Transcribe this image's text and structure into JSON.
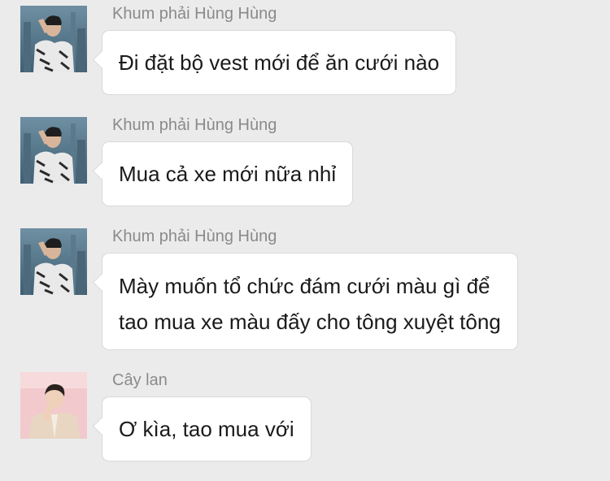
{
  "messages": [
    {
      "sender": "Khum phải Hùng Hùng",
      "avatar_icon": "male-avatar-city-icon",
      "lines": [
        "Đi đặt bộ vest mới để ăn cưới nào"
      ]
    },
    {
      "sender": "Khum phải Hùng Hùng",
      "avatar_icon": "male-avatar-city-icon",
      "lines": [
        "Mua cả xe mới nữa nhỉ"
      ]
    },
    {
      "sender": "Khum phải Hùng Hùng",
      "avatar_icon": "male-avatar-city-icon",
      "lines": [
        "Mày muốn tổ chức đám cưới màu gì để",
        "tao mua xe màu đấy cho tông xuyệt tông"
      ]
    },
    {
      "sender": "Cây lan",
      "avatar_icon": "male-avatar-pink-icon",
      "lines": [
        "Ơ kìa, tao mua với"
      ]
    }
  ],
  "colors": {
    "background": "#ebebeb",
    "bubble": "#ffffff",
    "sender_text": "#8a8a8a",
    "message_text": "#1a1a1a"
  }
}
